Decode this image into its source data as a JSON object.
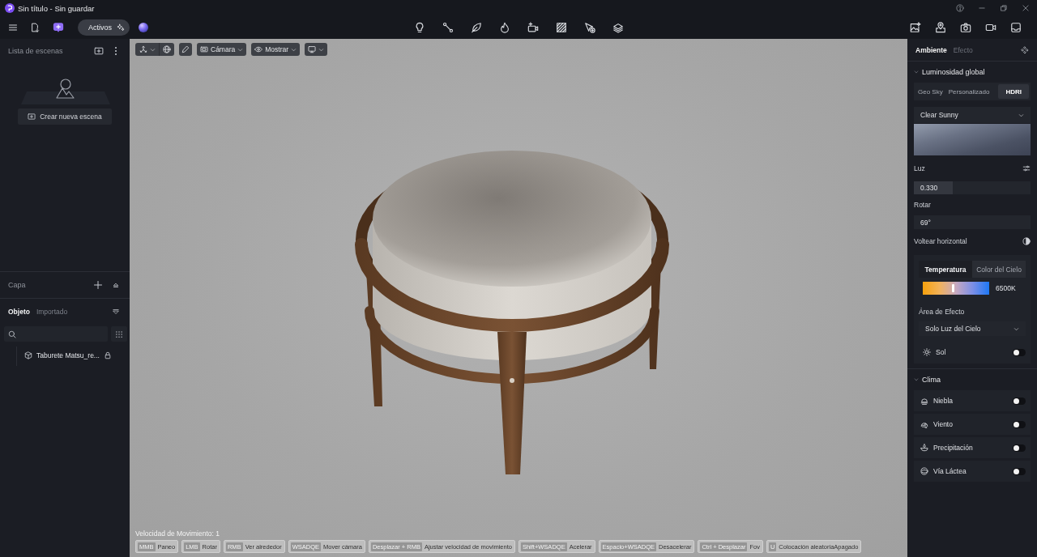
{
  "window": {
    "title": "Sin título - Sin guardar"
  },
  "toolbar": {
    "assets_button": "Activos"
  },
  "scene_list": {
    "title": "Lista de escenas",
    "create_button": "Crear nueva escena"
  },
  "layer_panel": {
    "title": "Capa"
  },
  "object_panel": {
    "tabs": [
      {
        "label": "Objeto",
        "selected": true
      },
      {
        "label": "Importado",
        "selected": false
      }
    ],
    "items": [
      {
        "label": "Taburete Matsu_re...",
        "locked": true
      }
    ]
  },
  "viewport": {
    "camera_button": "Cámara",
    "show_button": "Mostrar",
    "speed_label": "Velocidad de Movimiento: 1",
    "shortcuts": [
      {
        "key": "MMB",
        "action": "Paneo"
      },
      {
        "key": "LMB",
        "action": "Rotar"
      },
      {
        "key": "RMB",
        "action": "Ver alrededor"
      },
      {
        "key": "WSADQE",
        "action": "Mover cámara"
      },
      {
        "key": "Desplazar + RMB",
        "action": "Ajustar velocidad de movimiento"
      },
      {
        "key": "Shift+WSADQE",
        "action": "Acelerar"
      },
      {
        "key": "Espacio+WSADQE",
        "action": "Desacelerar"
      },
      {
        "key": "Ctrl + Desplazar",
        "action": "Fov"
      },
      {
        "key": "U",
        "action": "Colocación aleatoriaApagado"
      }
    ]
  },
  "inspector": {
    "tabs": [
      {
        "label": "Ambiente",
        "selected": true
      },
      {
        "label": "Efecto",
        "selected": false
      }
    ],
    "global_light": {
      "title": "Luminosidad global",
      "expanded": true,
      "modes": [
        {
          "label": "Geo Sky",
          "selected": false
        },
        {
          "label": "Personalizado",
          "selected": false
        },
        {
          "label": "HDRI",
          "selected": true
        }
      ],
      "hdri": "Clear Sunny",
      "light": {
        "label": "Luz",
        "value": "0.330",
        "level": 0.33
      },
      "rotate": {
        "label": "Rotar",
        "value": "69°"
      },
      "flip": {
        "label": "Voltear horizontal"
      },
      "color_tabs": [
        {
          "label": "Temperatura",
          "selected": true
        },
        {
          "label": "Color del Cielo",
          "selected": false
        }
      ],
      "temperature": {
        "value": "6500K",
        "level": 0.45
      },
      "effect_area": {
        "label": "Área de Efecto",
        "value": "Solo Luz del Cielo"
      },
      "sun": {
        "label": "Sol",
        "on": false
      }
    },
    "weather": {
      "title": "Clima",
      "expanded": true,
      "items": [
        {
          "kind": "fog",
          "label": "Niebla",
          "on": false
        },
        {
          "kind": "wind",
          "label": "Viento",
          "on": false
        },
        {
          "kind": "precipitation",
          "label": "Precipitación",
          "on": false
        },
        {
          "kind": "milky_way",
          "label": "Vía Láctea",
          "on": false
        }
      ]
    }
  }
}
